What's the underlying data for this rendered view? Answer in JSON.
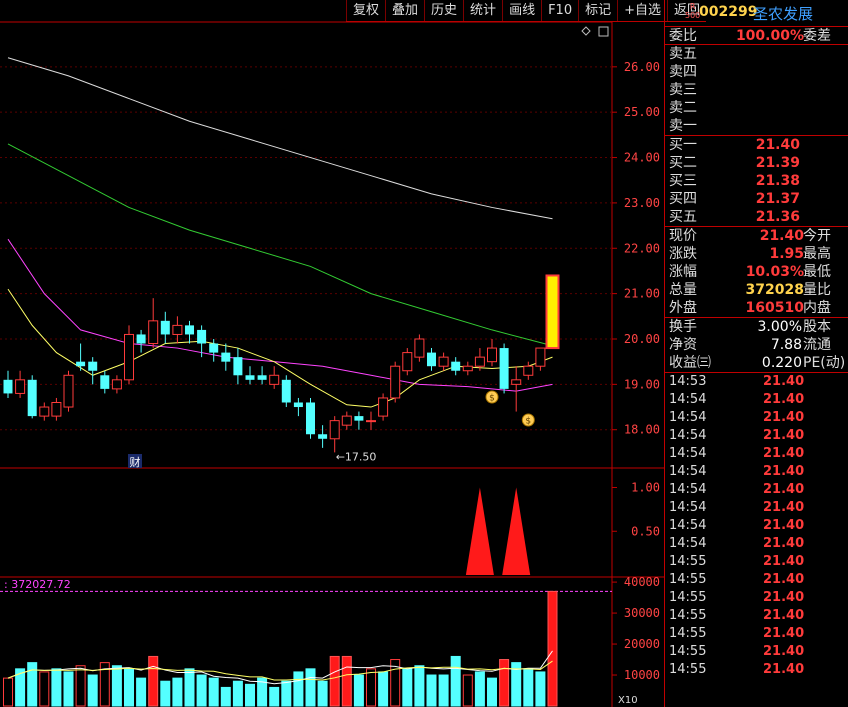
{
  "toolbar": [
    "复权",
    "叠加",
    "历史",
    "统计",
    "画线",
    "F10",
    "标记",
    "+自选",
    "返回"
  ],
  "stock": {
    "market_tag_top": "R",
    "market_tag_bottom": "500",
    "code": "002299",
    "name": "圣农发展"
  },
  "quote_ratio": {
    "label": "委比",
    "value": "100.00%",
    "label2": "委差"
  },
  "sell": [
    {
      "label": "卖五"
    },
    {
      "label": "卖四"
    },
    {
      "label": "卖三"
    },
    {
      "label": "卖二"
    },
    {
      "label": "卖一"
    }
  ],
  "buy": [
    {
      "label": "买一",
      "price": "21.40"
    },
    {
      "label": "买二",
      "price": "21.39"
    },
    {
      "label": "买三",
      "price": "21.38"
    },
    {
      "label": "买四",
      "price": "21.37"
    },
    {
      "label": "买五",
      "price": "21.36"
    }
  ],
  "stats1": [
    {
      "label": "现价",
      "value": "21.40",
      "label2": "今开",
      "color": "red"
    },
    {
      "label": "涨跌",
      "value": "1.95",
      "label2": "最高",
      "color": "red"
    },
    {
      "label": "涨幅",
      "value": "10.03%",
      "label2": "最低",
      "color": "red"
    },
    {
      "label": "总量",
      "value": "372028",
      "label2": "量比",
      "color": "yellow"
    },
    {
      "label": "外盘",
      "value": "160510",
      "label2": "内盘",
      "color": "red"
    }
  ],
  "stats2": [
    {
      "label": "换手",
      "value": "3.00%",
      "label2": "股本"
    },
    {
      "label": "净资",
      "value": "7.88",
      "label2": "流通"
    },
    {
      "label": "收益㈢",
      "value": "0.220",
      "label2": "PE(动)"
    }
  ],
  "ticks": [
    {
      "time": "14:53",
      "price": "21.40"
    },
    {
      "time": "14:54",
      "price": "21.40"
    },
    {
      "time": "14:54",
      "price": "21.40"
    },
    {
      "time": "14:54",
      "price": "21.40"
    },
    {
      "time": "14:54",
      "price": "21.40"
    },
    {
      "time": "14:54",
      "price": "21.40"
    },
    {
      "time": "14:54",
      "price": "21.40"
    },
    {
      "time": "14:54",
      "price": "21.40"
    },
    {
      "time": "14:54",
      "price": "21.40"
    },
    {
      "time": "14:54",
      "price": "21.40"
    },
    {
      "time": "14:55",
      "price": "21.40"
    },
    {
      "time": "14:55",
      "price": "21.40"
    },
    {
      "time": "14:55",
      "price": "21.40"
    },
    {
      "time": "14:55",
      "price": "21.40"
    },
    {
      "time": "14:55",
      "price": "21.40"
    },
    {
      "time": "14:55",
      "price": "21.40"
    },
    {
      "time": "14:55",
      "price": "21.40"
    }
  ],
  "chart_labels": {
    "low_marker": "←17.50",
    "volume_readout": ": 372027.72",
    "finance_badge": "财",
    "volume_unit": "X10"
  },
  "colors": {
    "up": "#ff3b3b",
    "down": "#54ffff",
    "ma_white": "#dddddd",
    "ma_yellow": "#ffff66",
    "ma_magenta": "#ff44ff",
    "ma_green": "#33cc33",
    "border": "#c00000"
  },
  "chart_data": [
    {
      "type": "candlestick",
      "y_ticks": [
        "26.00",
        "25.00",
        "24.00",
        "23.00",
        "22.00",
        "21.00",
        "20.00",
        "19.00",
        "18.00"
      ],
      "ylim": [
        17.2,
        26.9
      ],
      "candles": [
        {
          "o": 19.1,
          "c": 18.8,
          "h": 19.3,
          "l": 18.7
        },
        {
          "o": 18.8,
          "c": 19.1,
          "h": 19.3,
          "l": 18.7
        },
        {
          "o": 19.1,
          "c": 18.3,
          "h": 19.2,
          "l": 18.25
        },
        {
          "o": 18.3,
          "c": 18.5,
          "h": 18.6,
          "l": 18.2
        },
        {
          "o": 18.3,
          "c": 18.6,
          "h": 18.7,
          "l": 18.2
        },
        {
          "o": 18.5,
          "c": 19.2,
          "h": 19.3,
          "l": 18.4
        },
        {
          "o": 19.5,
          "c": 19.4,
          "h": 19.9,
          "l": 19.3
        },
        {
          "o": 19.5,
          "c": 19.3,
          "h": 19.6,
          "l": 19.0
        },
        {
          "o": 19.2,
          "c": 18.9,
          "h": 19.3,
          "l": 18.8
        },
        {
          "o": 18.9,
          "c": 19.1,
          "h": 19.2,
          "l": 18.8
        },
        {
          "o": 19.1,
          "c": 20.1,
          "h": 20.3,
          "l": 19.0
        },
        {
          "o": 20.1,
          "c": 19.9,
          "h": 20.2,
          "l": 19.7
        },
        {
          "o": 19.9,
          "c": 20.4,
          "h": 20.9,
          "l": 19.8
        },
        {
          "o": 20.4,
          "c": 20.1,
          "h": 20.6,
          "l": 19.9
        },
        {
          "o": 20.1,
          "c": 20.3,
          "h": 20.5,
          "l": 19.9
        },
        {
          "o": 20.3,
          "c": 20.1,
          "h": 20.4,
          "l": 19.9
        },
        {
          "o": 20.2,
          "c": 19.9,
          "h": 20.3,
          "l": 19.6
        },
        {
          "o": 19.9,
          "c": 19.7,
          "h": 20.0,
          "l": 19.5
        },
        {
          "o": 19.7,
          "c": 19.5,
          "h": 19.9,
          "l": 19.3
        },
        {
          "o": 19.6,
          "c": 19.2,
          "h": 19.8,
          "l": 19.0
        },
        {
          "o": 19.2,
          "c": 19.1,
          "h": 19.4,
          "l": 19.0
        },
        {
          "o": 19.2,
          "c": 19.1,
          "h": 19.4,
          "l": 19.0
        },
        {
          "o": 19.0,
          "c": 19.2,
          "h": 19.4,
          "l": 18.9
        },
        {
          "o": 19.1,
          "c": 18.6,
          "h": 19.2,
          "l": 18.5
        },
        {
          "o": 18.6,
          "c": 18.5,
          "h": 18.7,
          "l": 18.3
        },
        {
          "o": 18.6,
          "c": 17.9,
          "h": 18.7,
          "l": 17.8
        },
        {
          "o": 17.9,
          "c": 17.8,
          "h": 18.1,
          "l": 17.6
        },
        {
          "o": 17.8,
          "c": 18.2,
          "h": 18.3,
          "l": 17.5
        },
        {
          "o": 18.1,
          "c": 18.3,
          "h": 18.4,
          "l": 18.0
        },
        {
          "o": 18.3,
          "c": 18.2,
          "h": 18.4,
          "l": 18.0
        },
        {
          "o": 18.2,
          "c": 18.2,
          "h": 18.4,
          "l": 18.0
        },
        {
          "o": 18.3,
          "c": 18.7,
          "h": 18.8,
          "l": 18.2
        },
        {
          "o": 18.7,
          "c": 19.4,
          "h": 19.5,
          "l": 18.6
        },
        {
          "o": 19.3,
          "c": 19.7,
          "h": 19.8,
          "l": 19.2
        },
        {
          "o": 19.6,
          "c": 20.0,
          "h": 20.1,
          "l": 19.5
        },
        {
          "o": 19.7,
          "c": 19.4,
          "h": 19.8,
          "l": 19.3
        },
        {
          "o": 19.4,
          "c": 19.6,
          "h": 19.7,
          "l": 19.3
        },
        {
          "o": 19.5,
          "c": 19.3,
          "h": 19.6,
          "l": 19.2
        },
        {
          "o": 19.3,
          "c": 19.4,
          "h": 19.5,
          "l": 19.2
        },
        {
          "o": 19.4,
          "c": 19.6,
          "h": 19.8,
          "l": 19.3
        },
        {
          "o": 19.5,
          "c": 19.8,
          "h": 20.0,
          "l": 19.4
        },
        {
          "o": 19.8,
          "c": 18.9,
          "h": 19.9,
          "l": 18.8
        },
        {
          "o": 19.0,
          "c": 19.1,
          "h": 19.4,
          "l": 18.4
        },
        {
          "o": 19.2,
          "c": 19.4,
          "h": 19.5,
          "l": 19.1
        },
        {
          "o": 19.4,
          "c": 19.8,
          "h": 19.8,
          "l": 19.3
        },
        {
          "o": 19.8,
          "c": 21.4,
          "h": 21.4,
          "l": 19.8
        }
      ],
      "ma": [
        {
          "color": "ma_white",
          "values": [
            [
              0,
              26.2
            ],
            [
              5,
              25.8
            ],
            [
              10,
              25.3
            ],
            [
              15,
              24.8
            ],
            [
              20,
              24.4
            ],
            [
              25,
              24.0
            ],
            [
              30,
              23.6
            ],
            [
              35,
              23.2
            ],
            [
              40,
              22.9
            ],
            [
              45,
              22.65
            ]
          ]
        },
        {
          "color": "ma_green",
          "values": [
            [
              0,
              24.3
            ],
            [
              5,
              23.6
            ],
            [
              10,
              22.9
            ],
            [
              15,
              22.4
            ],
            [
              20,
              22.0
            ],
            [
              25,
              21.6
            ],
            [
              30,
              21.0
            ],
            [
              35,
              20.6
            ],
            [
              40,
              20.2
            ],
            [
              45,
              19.85
            ]
          ]
        },
        {
          "color": "ma_magenta",
          "values": [
            [
              0,
              22.2
            ],
            [
              3,
              21.0
            ],
            [
              6,
              20.2
            ],
            [
              10,
              19.9
            ],
            [
              14,
              19.8
            ],
            [
              18,
              19.6
            ],
            [
              22,
              19.5
            ],
            [
              26,
              19.4
            ],
            [
              30,
              19.2
            ],
            [
              34,
              19.0
            ],
            [
              38,
              18.95
            ],
            [
              42,
              18.85
            ],
            [
              45,
              19.0
            ]
          ]
        },
        {
          "color": "ma_yellow",
          "values": [
            [
              0,
              21.1
            ],
            [
              2,
              20.3
            ],
            [
              4,
              19.7
            ],
            [
              7,
              19.2
            ],
            [
              10,
              19.5
            ],
            [
              13,
              19.9
            ],
            [
              16,
              19.95
            ],
            [
              19,
              19.8
            ],
            [
              22,
              19.5
            ],
            [
              25,
              19.0
            ],
            [
              28,
              18.55
            ],
            [
              30,
              18.5
            ],
            [
              32,
              18.7
            ],
            [
              34,
              19.1
            ],
            [
              37,
              19.4
            ],
            [
              40,
              19.35
            ],
            [
              43,
              19.4
            ],
            [
              45,
              19.6
            ]
          ]
        }
      ]
    },
    {
      "type": "indicator",
      "y_ticks": [
        "1.00",
        "0.50"
      ],
      "ylim": [
        0,
        1.2
      ],
      "triangles": [
        {
          "index": 39,
          "value": 1.0
        },
        {
          "index": 42,
          "value": 1.0
        }
      ]
    },
    {
      "type": "bar",
      "y_ticks": [
        "40000",
        "30000",
        "20000",
        "10000"
      ],
      "ylim": [
        0,
        41000
      ],
      "values": [
        9000,
        12000,
        14000,
        11000,
        12000,
        11000,
        13000,
        10000,
        14000,
        13000,
        12000,
        9000,
        16000,
        8000,
        9000,
        12000,
        10000,
        9000,
        6000,
        8000,
        7000,
        9000,
        6000,
        8000,
        11000,
        12000,
        8000,
        16000,
        16000,
        10000,
        12000,
        11000,
        15000,
        12000,
        13000,
        10000,
        10000,
        16000,
        10000,
        11000,
        9000,
        15000,
        14000,
        12000,
        11000,
        37000
      ],
      "up": [
        1,
        0,
        0,
        1,
        0,
        0,
        1,
        0,
        1,
        0,
        0,
        0,
        1,
        0,
        0,
        0,
        0,
        0,
        0,
        0,
        0,
        0,
        0,
        0,
        0,
        0,
        0,
        1,
        1,
        0,
        1,
        0,
        1,
        0,
        0,
        0,
        0,
        0,
        1,
        0,
        0,
        1,
        0,
        0,
        0,
        1
      ],
      "highlight": [
        12,
        27,
        28,
        41,
        45
      ]
    }
  ]
}
